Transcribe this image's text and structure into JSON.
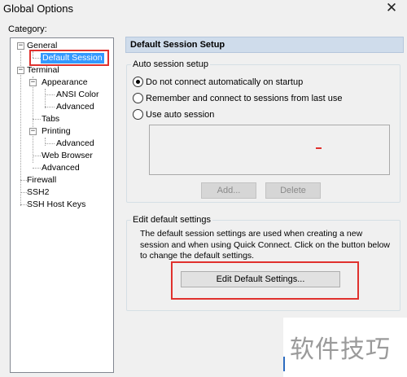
{
  "window": {
    "title": "Global Options",
    "close_label": "✕"
  },
  "category_label": "Category:",
  "tree": {
    "general": "General",
    "default_session": "Default Session",
    "terminal": "Terminal",
    "appearance": "Appearance",
    "ansi_color": "ANSI Color",
    "appearance_advanced": "Advanced",
    "tabs": "Tabs",
    "printing": "Printing",
    "printing_advanced": "Advanced",
    "web_browser": "Web Browser",
    "terminal_advanced": "Advanced",
    "firewall": "Firewall",
    "ssh2": "SSH2",
    "ssh_host_keys": "SSH Host Keys",
    "expanded_glyph": "−"
  },
  "panel": {
    "header": "Default Session Setup",
    "auto_group_title": "Auto session setup",
    "radio_options": [
      {
        "label": "Do not connect automatically on startup",
        "selected": true
      },
      {
        "label": "Remember and connect to sessions from last use",
        "selected": false
      },
      {
        "label": "Use auto session",
        "selected": false
      }
    ],
    "add_button": "Add...",
    "delete_button": "Delete",
    "edit_group_title": "Edit default settings",
    "edit_description": "The default session settings are used when creating a new session and when using Quick Connect.  Click on the button below to change the default settings.",
    "edit_button": "Edit Default Settings..."
  },
  "watermark": "软件技巧",
  "colors": {
    "highlight": "#e0312d",
    "selection": "#3399ff",
    "header_bg": "#cfdceb"
  }
}
